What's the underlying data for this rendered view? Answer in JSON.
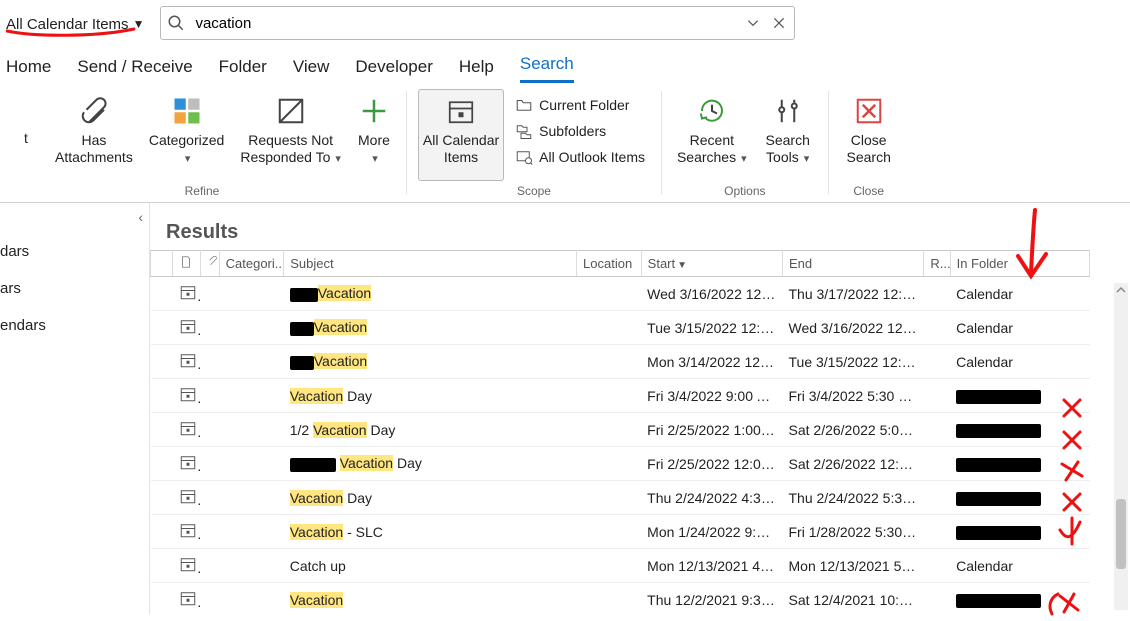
{
  "searchScope": "All Calendar Items",
  "searchQuery": "vacation",
  "tabs": [
    "Home",
    "Send / Receive",
    "Folder",
    "View",
    "Developer",
    "Help",
    "Search"
  ],
  "activeTab": "Search",
  "ribbon": {
    "refine": {
      "hasAttachments": "Has\nAttachments",
      "categorized": "Categorized",
      "requestsNotResponded": "Requests Not\nResponded To",
      "more": "More",
      "groupLabel": "Refine",
      "partialLeft": "t"
    },
    "scope": {
      "allCalendarItems": "All Calendar\nItems",
      "currentFolder": "Current Folder",
      "subfolders": "Subfolders",
      "allOutlook": "All Outlook Items",
      "groupLabel": "Scope"
    },
    "options": {
      "recentSearches": "Recent\nSearches",
      "searchTools": "Search\nTools",
      "groupLabel": "Options"
    },
    "close": {
      "closeSearch": "Close\nSearch",
      "groupLabel": "Close"
    }
  },
  "leftPane": {
    "items": [
      "dars",
      "ars",
      "endars"
    ]
  },
  "resultsHeader": "Results",
  "columns": {
    "icon": "",
    "attach": "",
    "categories": "Categori...",
    "subject": "Subject",
    "location": "Location",
    "start": "Start",
    "end": "End",
    "recurrence": "R...",
    "inFolder": "In Folder"
  },
  "rows": [
    {
      "prefixRedact": 28,
      "prefixText": "",
      "hl": "Vacation",
      "suffix": "",
      "start": "Wed 3/16/2022 12:00...",
      "end": "Thu 3/17/2022 12:00 ...",
      "folder": "Calendar",
      "folderRedact": 0
    },
    {
      "prefixRedact": 24,
      "prefixText": "",
      "hl": "Vacation",
      "suffix": "",
      "start": "Tue 3/15/2022 12:00 ...",
      "end": "Wed 3/16/2022 12:00...",
      "folder": "Calendar",
      "folderRedact": 0
    },
    {
      "prefixRedact": 24,
      "prefixText": "",
      "hl": "Vacation",
      "suffix": "",
      "start": "Mon 3/14/2022 12:00...",
      "end": "Tue 3/15/2022 12:00 ...",
      "folder": "Calendar",
      "folderRedact": 0
    },
    {
      "prefixRedact": 0,
      "prefixText": "",
      "hl": "Vacation",
      "suffix": " Day",
      "start": "Fri 3/4/2022 9:00 AM",
      "end": "Fri 3/4/2022 5:30 PM",
      "folder": "",
      "folderRedact": 85
    },
    {
      "prefixRedact": 0,
      "prefixText": "1/2 ",
      "hl": "Vacation",
      "suffix": " Day",
      "start": "Fri 2/25/2022 1:00 PM",
      "end": "Sat 2/26/2022 5:00 AM",
      "folder": "",
      "folderRedact": 85
    },
    {
      "prefixRedact": 46,
      "prefixText": " ",
      "hl": "Vacation",
      "suffix": " Day",
      "start": "Fri 2/25/2022 12:00 A...",
      "end": "Sat 2/26/2022 12:00 ...",
      "folder": "",
      "folderRedact": 85
    },
    {
      "prefixRedact": 0,
      "prefixText": "",
      "hl": "Vacation",
      "suffix": " Day",
      "start": "Thu 2/24/2022 4:30 A...",
      "end": "Thu 2/24/2022 5:30 PM",
      "folder": "",
      "folderRedact": 85
    },
    {
      "prefixRedact": 0,
      "prefixText": "",
      "hl": "Vacation",
      "suffix": " - SLC",
      "start": "Mon 1/24/2022 9:00 ...",
      "end": "Fri 1/28/2022 5:30 PM",
      "folder": "",
      "folderRedact": 85
    },
    {
      "prefixRedact": 0,
      "prefixText": "",
      "hl": "",
      "suffix": "Catch up",
      "start": "Mon 12/13/2021 4:00...",
      "end": "Mon 12/13/2021 5:00...",
      "folder": "Calendar",
      "folderRedact": 0
    },
    {
      "prefixRedact": 0,
      "prefixText": "",
      "hl": "Vacation",
      "suffix": "",
      "start": "Thu 12/2/2021 9:30 A...",
      "end": "Sat 12/4/2021 10:00 ...",
      "folder": "",
      "folderRedact": 85
    }
  ]
}
